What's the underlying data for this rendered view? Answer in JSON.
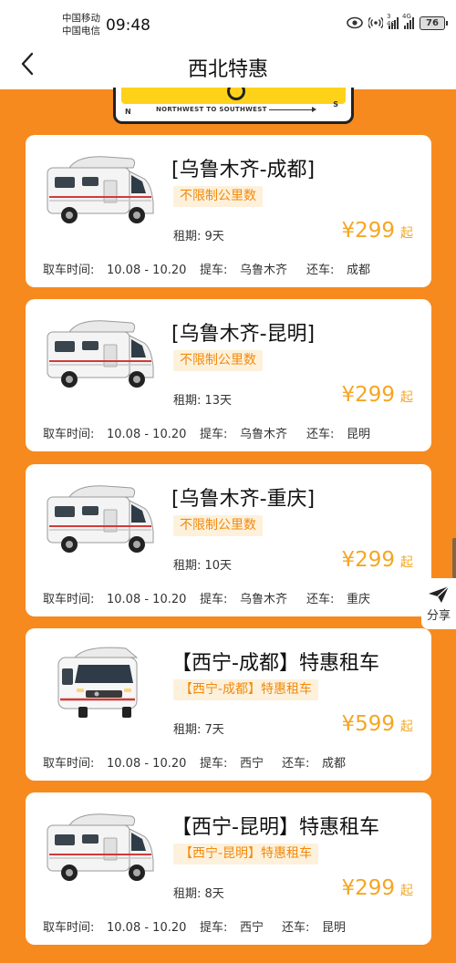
{
  "status_bar": {
    "carrier_1": "中国移动",
    "carrier_2": "中国电信",
    "time": "09:48",
    "signal_1_tag": "3 4G",
    "signal_2_tag": "4G",
    "battery": "76"
  },
  "nav": {
    "title": "西北特惠"
  },
  "banner": {
    "route_text": "NORTHWEST TO SOUTHWEST",
    "left_letter": "N",
    "right_letter": "S"
  },
  "colors": {
    "background": "#f68a1f",
    "price": "#f5a623",
    "tag_text": "#f28a0c",
    "tag_bg": "#fdf1dc"
  },
  "labels": {
    "pickup_time": "取车时间:",
    "pickup_place": "提车:",
    "return_place": "还车:",
    "price_suffix": "起"
  },
  "offers": [
    {
      "route": "[乌鲁木齐-成都]",
      "tag": "不限制公里数",
      "duration": "租期: 9天",
      "price": "¥299",
      "dates": "10.08 - 10.20",
      "pickup": "乌鲁木齐",
      "return": "成都",
      "image": "rv-motorhome-side"
    },
    {
      "route": "[乌鲁木齐-昆明]",
      "tag": "不限制公里数",
      "duration": "租期: 13天",
      "price": "¥299",
      "dates": "10.08 - 10.20",
      "pickup": "乌鲁木齐",
      "return": "昆明",
      "image": "rv-motorhome-side"
    },
    {
      "route": "[乌鲁木齐-重庆]",
      "tag": "不限制公里数",
      "duration": "租期: 10天",
      "price": "¥299",
      "dates": "10.08 - 10.20",
      "pickup": "乌鲁木齐",
      "return": "重庆",
      "image": "rv-motorhome-side"
    },
    {
      "route": "【西宁-成都】特惠租车",
      "tag": "【西宁-成都】特惠租车",
      "duration": "租期: 7天",
      "price": "¥599",
      "dates": "10.08 - 10.20",
      "pickup": "西宁",
      "return": "成都",
      "image": "rv-motorhome-front"
    },
    {
      "route": "【西宁-昆明】特惠租车",
      "tag": "【西宁-昆明】特惠租车",
      "duration": "租期: 8天",
      "price": "¥299",
      "dates": "10.08 - 10.20",
      "pickup": "西宁",
      "return": "昆明",
      "image": "rv-motorhome-side"
    }
  ],
  "share": {
    "label": "分享",
    "icon": "share-plane-icon"
  }
}
